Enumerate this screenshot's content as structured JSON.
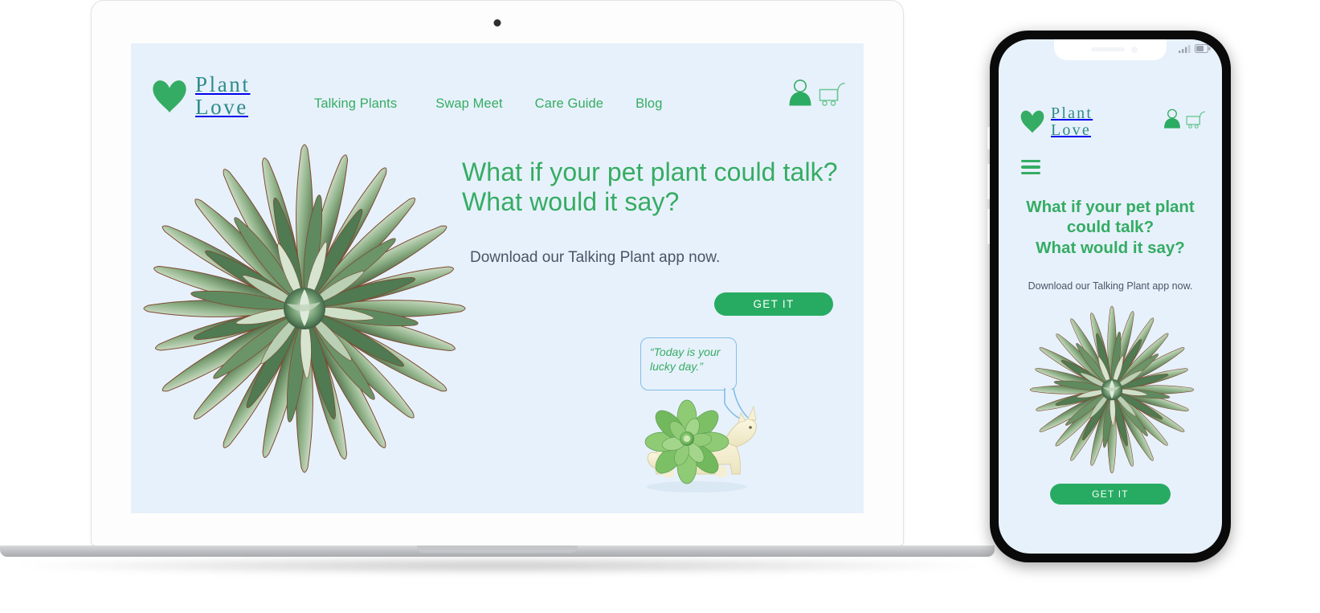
{
  "brand": {
    "line1": "Plant",
    "line2": "Love",
    "heart_icon": "heart-icon",
    "color": "#2e8b8b",
    "heart_color": "#35ac63"
  },
  "nav": {
    "items": [
      {
        "label": "Talking Plants"
      },
      {
        "label": "Swap Meet"
      },
      {
        "label": "Care Guide"
      },
      {
        "label": "Blog"
      }
    ],
    "color": "#35ac63"
  },
  "header_actions": {
    "account_icon": "user-account-icon",
    "cart_icon": "shopping-cart-icon"
  },
  "hero": {
    "headline_line1": "What if your pet plant could talk?",
    "headline_line2": "What would it say?",
    "subtext": "Download our Talking Plant app now.",
    "cta_label": "GET IT",
    "cta_color": "#27ab62",
    "headline_color": "#35ac63",
    "plant_image": "agave-succulent-rosette-photo"
  },
  "speech_bubble": {
    "line1": "“Today is your",
    "line2": "lucky day.”",
    "border_color": "#83bfe8",
    "text_color": "#35ac63"
  },
  "figurine": {
    "name": "unicorn-succulent-planter"
  },
  "mobile": {
    "brand": {
      "line1": "Plant",
      "line2": "Love"
    },
    "menu_icon": "hamburger-menu-icon",
    "account_icon": "user-account-icon",
    "cart_icon": "shopping-cart-icon",
    "headline_line1": "What if your pet plant",
    "headline_line2": "could talk?",
    "headline_line3": "What would it say?",
    "subtext": "Download our Talking Plant app now.",
    "cta_label": "GET IT",
    "plant_image": "agave-succulent-rosette-photo",
    "status_icons": {
      "signal": "cellular-signal-icon",
      "battery": "battery-icon"
    }
  },
  "page_background": "#ffffff",
  "site_background": "#e7f1fb"
}
